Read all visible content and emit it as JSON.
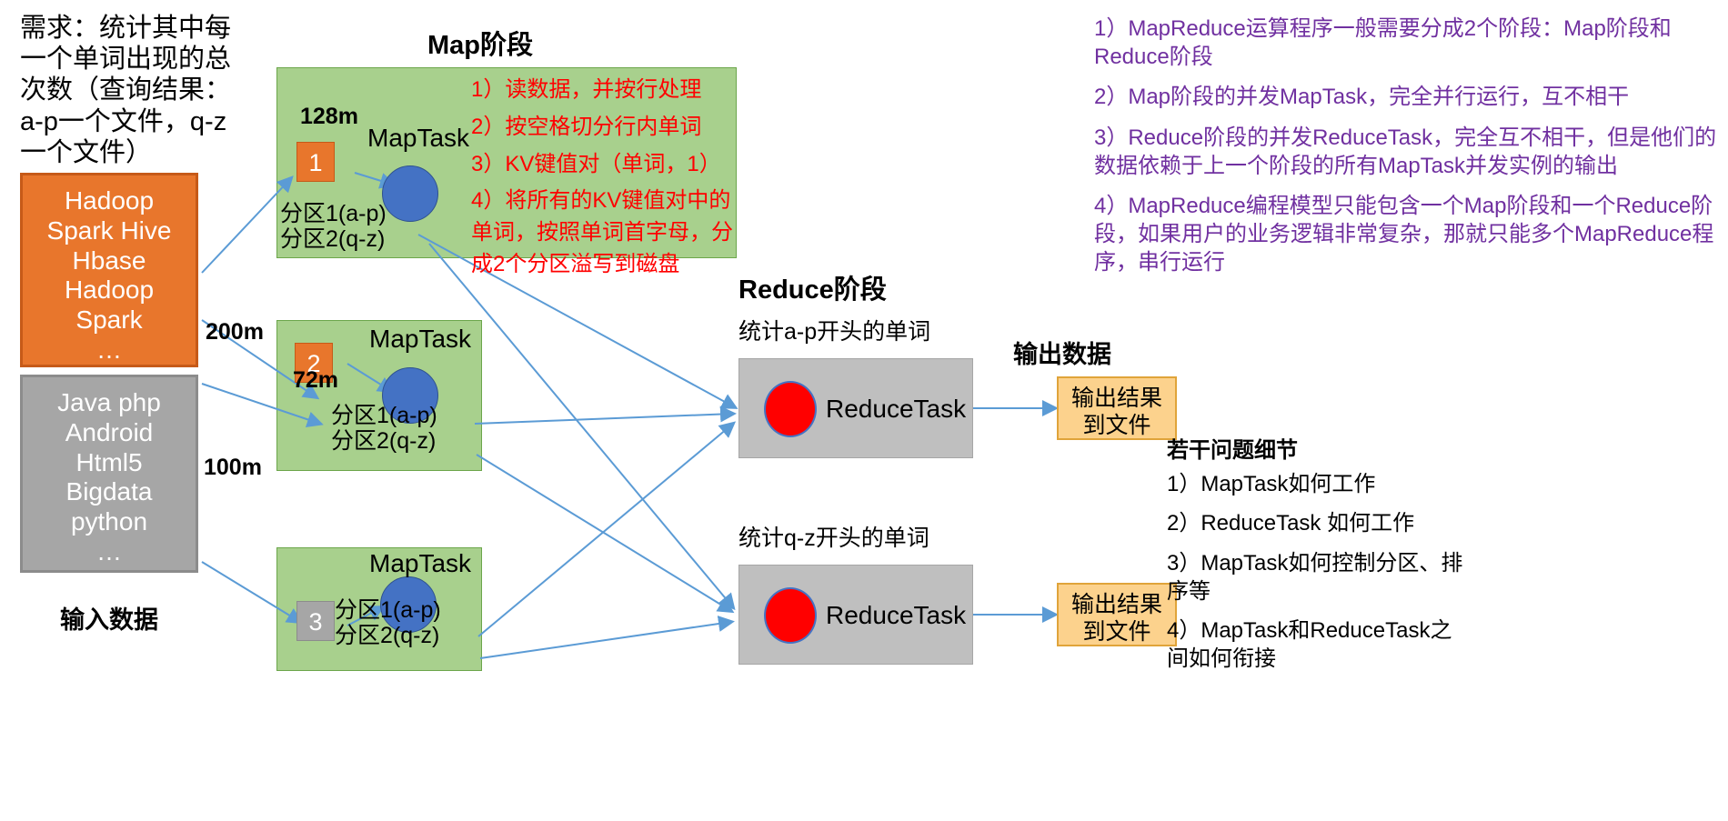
{
  "requirement": {
    "text": "需求：统计其中每\n一个单词出现的总\n次数（查询结果：\na-p一个文件，q-z\n一个文件）"
  },
  "input": {
    "label": "输入数据",
    "boxes": [
      {
        "name": "orange-input",
        "text": "Hadoop\nSpark Hive\nHbase\nHadoop\nSpark\n…",
        "color": "#E8762C"
      },
      {
        "name": "gray-input",
        "text": "Java php\nAndroid\nHtml5\nBigdata\npython\n…",
        "color": "#A6A6A6"
      }
    ]
  },
  "map_stage": {
    "title": "Map阶段",
    "tasks": [
      {
        "chip": "1",
        "chip_color": "#E8762C",
        "size": "128m",
        "task_label": "MapTask",
        "partitions": "分区1(a-p)\n分区2(q-z)"
      },
      {
        "chip": "2",
        "chip_color": "#E8762C",
        "size": "72m",
        "task_label": "MapTask",
        "partitions": "分区1(a-p)\n分区2(q-z)"
      },
      {
        "chip": "3",
        "chip_color": "#A6A6A6",
        "size": "",
        "task_label": "MapTask",
        "partitions": "分区1(a-p)\n分区2(q-z)"
      }
    ],
    "split_sizes": [
      "200m",
      "100m"
    ],
    "steps": [
      "1）读数据，并按行处理",
      "2）按空格切分行内单词",
      "3）KV键值对（单词，1）",
      "4）将所有的KV键值对中的单词，按照单词首字母，分成2个分区溢写到磁盘"
    ],
    "steps_color": "#FF0000"
  },
  "reduce_stage": {
    "title": "Reduce阶段",
    "tasks": [
      {
        "caption": "统计a-p开头的单词",
        "label": "ReduceTask"
      },
      {
        "caption": "统计q-z开头的单词",
        "label": "ReduceTask"
      }
    ]
  },
  "output": {
    "label": "输出数据",
    "boxes": [
      {
        "text": "输出结果\n到文件"
      },
      {
        "text": "输出结果\n到文件"
      }
    ]
  },
  "notes": {
    "color": "#7030A0",
    "items": [
      "1）MapReduce运算程序一般需要分成2个阶段：Map阶段和Reduce阶段",
      "2）Map阶段的并发MapTask，完全并行运行，互不相干",
      "3）Reduce阶段的并发ReduceTask，完全互不相干，但是他们的数据依赖于上一个阶段的所有MapTask并发实例的输出",
      "4）MapReduce编程模型只能包含一个Map阶段和一个Reduce阶段，如果用户的业务逻辑非常复杂，那就只能多个MapReduce程序，串行运行"
    ]
  },
  "questions": {
    "title": "若干问题细节",
    "items": [
      "1）MapTask如何工作",
      "2）ReduceTask 如何工作",
      "3）MapTask如何控制分区、排序等",
      "4）MapTask和ReduceTask之间如何衔接"
    ]
  },
  "colors": {
    "arrow": "#5B9BD5",
    "map_box": "#A8D08D",
    "reduce_box": "#BFBFBF",
    "output_box": "#FCD28D",
    "map_circle": "#4472C4",
    "reduce_circle": "#FF0000"
  }
}
